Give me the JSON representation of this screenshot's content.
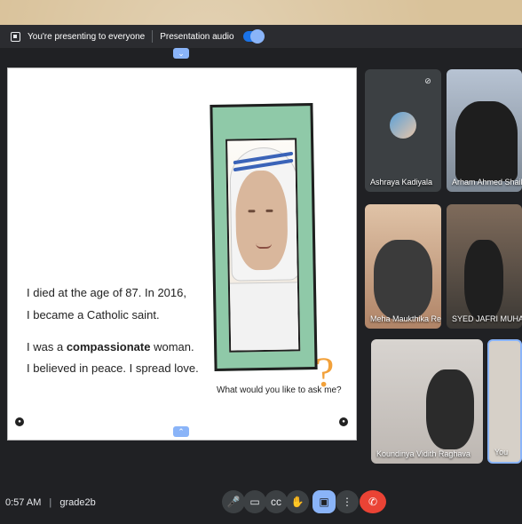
{
  "present_bar": {
    "presenting_text": "You're presenting to everyone",
    "audio_label": "Presentation audio",
    "audio_toggle_state": "on"
  },
  "slide": {
    "lines": [
      "I died at the age of 87. In 2016,",
      "I became a Catholic saint.",
      "I was a",
      "compassionate",
      "woman.",
      "I believed in peace. I spread love."
    ],
    "ask": "What would you like to ask me?"
  },
  "participants": [
    {
      "name": "Ashraya Kadiyala",
      "muted": true
    },
    {
      "name": "Arham Ahmed Shaik",
      "muted": false
    },
    {
      "name": "Meha Maukthika Re...",
      "muted": false
    },
    {
      "name": "SYED JAFRI MUHA...",
      "muted": false
    },
    {
      "name": "Koundinya Vidith Raghava",
      "muted": false
    },
    {
      "name": "You",
      "muted": false
    }
  ],
  "footer": {
    "time": "0:57 AM",
    "meeting": "grade2b"
  },
  "icons": [
    "present-icon",
    "mic-icon",
    "camera-icon",
    "captions-icon",
    "hand-icon",
    "present-now-icon",
    "more-icon",
    "end-call-icon"
  ],
  "colors": {
    "accent": "#1a73e8",
    "danger": "#ea4335",
    "frame": "#8fc9a8",
    "qmark": "#f2a13a"
  }
}
